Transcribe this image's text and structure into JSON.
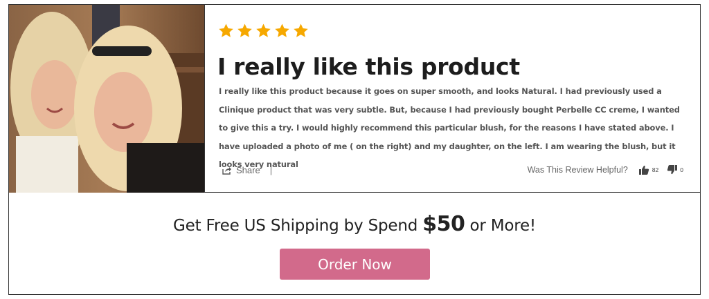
{
  "review": {
    "rating": 5,
    "star_color": "#f6a800",
    "title": "I really like this product",
    "text": "I really like this product because it goes on super smooth, and looks Natural. I had previously used a Clinique product that was very subtle. But, because I had previously bought Perbelle CC creme, I wanted to give this a try. I would highly recommend this particular blush, for the reasons I have stated above. I have uploaded a photo of me ( on the right) and my daughter, on the left. I am wearing the blush, but it looks very natural",
    "photo_icon": "review-photo"
  },
  "actions": {
    "share_label": "Share",
    "share_separator": "|",
    "helpful_question": "Was This Review Helpful?",
    "upvotes": "82",
    "downvotes": "0"
  },
  "promo": {
    "prefix": "Get Free US Shipping by Spend ",
    "amount": "$50",
    "suffix": " or More!",
    "button_label": "Order Now",
    "button_color": "#d26a8b"
  }
}
